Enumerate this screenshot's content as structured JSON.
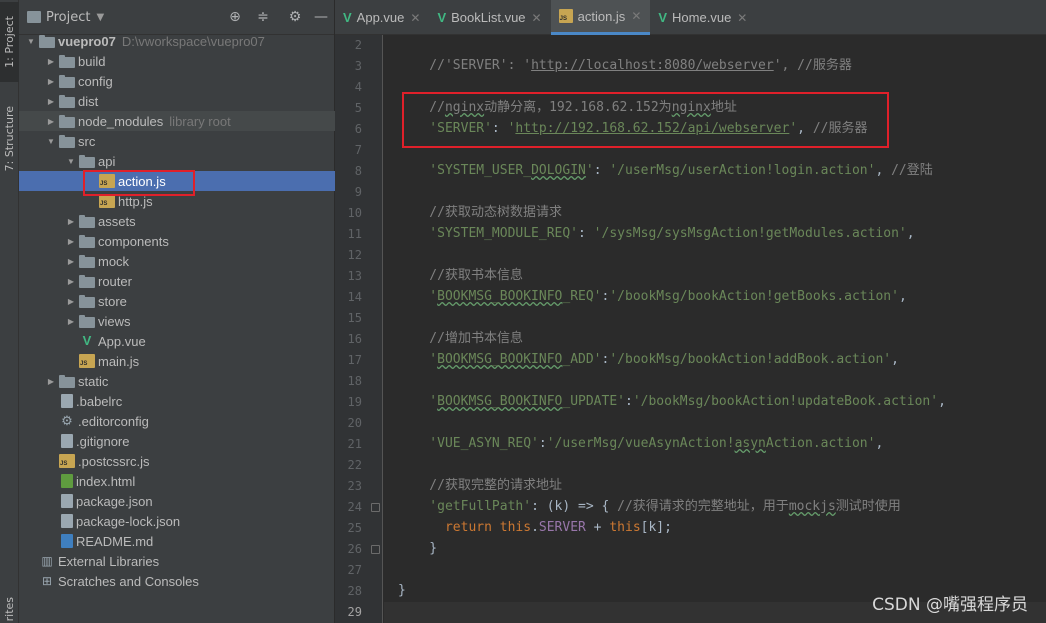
{
  "side_strip": {
    "project_tab": "1: Project",
    "structure_tab": "7: Structure",
    "bottom_tab": "rites"
  },
  "project_panel": {
    "title": "Project",
    "tree": [
      {
        "label": "vuepro07",
        "extra": "D:\\vworkspace\\vuepro07",
        "type": "folder",
        "depth": 0,
        "expanded": true
      },
      {
        "label": "build",
        "type": "folder",
        "depth": 1,
        "expanded": false
      },
      {
        "label": "config",
        "type": "folder",
        "depth": 1,
        "expanded": false
      },
      {
        "label": "dist",
        "type": "folder",
        "depth": 1,
        "expanded": false
      },
      {
        "label": "node_modules",
        "extra": "library root",
        "type": "folder",
        "depth": 1,
        "expanded": false,
        "highlight": true
      },
      {
        "label": "src",
        "type": "folder",
        "depth": 1,
        "expanded": true
      },
      {
        "label": "api",
        "type": "folder",
        "depth": 2,
        "expanded": true
      },
      {
        "label": "action.js",
        "type": "js",
        "depth": 3,
        "selected": true
      },
      {
        "label": "http.js",
        "type": "js",
        "depth": 3
      },
      {
        "label": "assets",
        "type": "folder",
        "depth": 2,
        "expanded": false
      },
      {
        "label": "components",
        "type": "folder",
        "depth": 2,
        "expanded": false
      },
      {
        "label": "mock",
        "type": "folder",
        "depth": 2,
        "expanded": false
      },
      {
        "label": "router",
        "type": "folder",
        "depth": 2,
        "expanded": false
      },
      {
        "label": "store",
        "type": "folder",
        "depth": 2,
        "expanded": false
      },
      {
        "label": "views",
        "type": "folder",
        "depth": 2,
        "expanded": false
      },
      {
        "label": "App.vue",
        "type": "vue",
        "depth": 2
      },
      {
        "label": "main.js",
        "type": "js",
        "depth": 2
      },
      {
        "label": "static",
        "type": "folder",
        "depth": 1,
        "expanded": false
      },
      {
        "label": ".babelrc",
        "type": "file",
        "depth": 1
      },
      {
        "label": ".editorconfig",
        "type": "gear",
        "depth": 1
      },
      {
        "label": ".gitignore",
        "type": "file",
        "depth": 1
      },
      {
        "label": ".postcssrc.js",
        "type": "js",
        "depth": 1
      },
      {
        "label": "index.html",
        "type": "html",
        "depth": 1
      },
      {
        "label": "package.json",
        "type": "file",
        "depth": 1
      },
      {
        "label": "package-lock.json",
        "type": "file",
        "depth": 1
      },
      {
        "label": "README.md",
        "type": "md",
        "depth": 1
      },
      {
        "label": "External Libraries",
        "type": "lib",
        "depth": 0
      },
      {
        "label": "Scratches and Consoles",
        "type": "scratch",
        "depth": 0
      }
    ]
  },
  "editor": {
    "tabs": [
      {
        "label": "App.vue",
        "icon": "vue-icon",
        "active": false
      },
      {
        "label": "BookList.vue",
        "icon": "vue-icon",
        "active": false
      },
      {
        "label": "action.js",
        "icon": "js-icon",
        "active": true
      },
      {
        "label": "Home.vue",
        "icon": "vue-icon",
        "active": false
      }
    ],
    "current_line": 29,
    "lines": [
      {
        "n": 2,
        "parts": []
      },
      {
        "n": 3,
        "parts": [
          [
            "c",
            "    //'SERVER': '"
          ],
          [
            "c u",
            "http://localhost:8080/webserver"
          ],
          [
            "c",
            "', //服务器"
          ]
        ]
      },
      {
        "n": 4,
        "parts": []
      },
      {
        "n": 5,
        "parts": [
          [
            "c",
            "    //"
          ],
          [
            "c w",
            "nginx"
          ],
          [
            "c",
            "动静分离，192.168.62.152为"
          ],
          [
            "c w",
            "nginx"
          ],
          [
            "c",
            "地址"
          ]
        ]
      },
      {
        "n": 6,
        "parts": [
          [
            "s",
            "    'SERVER'"
          ],
          [
            "op",
            ": "
          ],
          [
            "s",
            "'"
          ],
          [
            "s u",
            "http://192.168.62.152/api/webserver"
          ],
          [
            "s",
            "'"
          ],
          [
            "op",
            ", "
          ],
          [
            "c",
            "//服务器"
          ]
        ]
      },
      {
        "n": 7,
        "parts": []
      },
      {
        "n": 8,
        "parts": [
          [
            "s",
            "    'SYSTEM_USER_"
          ],
          [
            "s w",
            "DOLOGIN"
          ],
          [
            "s",
            "'"
          ],
          [
            "op",
            ": "
          ],
          [
            "s",
            "'/userMsg/userAction!login.action'"
          ],
          [
            "op",
            ", "
          ],
          [
            "c",
            "//登陆"
          ]
        ]
      },
      {
        "n": 9,
        "parts": []
      },
      {
        "n": 10,
        "parts": [
          [
            "c",
            "    //获取动态树数据请求"
          ]
        ]
      },
      {
        "n": 11,
        "parts": [
          [
            "s",
            "    'SYSTEM_MODULE_REQ'"
          ],
          [
            "op",
            ": "
          ],
          [
            "s",
            "'/sysMsg/sysMsgAction!getModules.action'"
          ],
          [
            "op",
            ","
          ]
        ]
      },
      {
        "n": 12,
        "parts": []
      },
      {
        "n": 13,
        "parts": [
          [
            "c",
            "    //获取书本信息"
          ]
        ]
      },
      {
        "n": 14,
        "parts": [
          [
            "s",
            "    '"
          ],
          [
            "s w",
            "BOOKMSG_BOOKINFO"
          ],
          [
            "s",
            "_REQ'"
          ],
          [
            "op",
            ":"
          ],
          [
            "s",
            "'/bookMsg/bookAction!getBooks.action'"
          ],
          [
            "op",
            ","
          ]
        ]
      },
      {
        "n": 15,
        "parts": []
      },
      {
        "n": 16,
        "parts": [
          [
            "c",
            "    //增加书本信息"
          ]
        ]
      },
      {
        "n": 17,
        "parts": [
          [
            "s",
            "    '"
          ],
          [
            "s w",
            "BOOKMSG_BOOKINFO"
          ],
          [
            "s",
            "_ADD'"
          ],
          [
            "op",
            ":"
          ],
          [
            "s",
            "'/bookMsg/bookAction!addBook.action'"
          ],
          [
            "op",
            ","
          ]
        ]
      },
      {
        "n": 18,
        "parts": []
      },
      {
        "n": 19,
        "parts": [
          [
            "s",
            "    '"
          ],
          [
            "s w",
            "BOOKMSG_BOOKINFO"
          ],
          [
            "s",
            "_UPDATE'"
          ],
          [
            "op",
            ":"
          ],
          [
            "s",
            "'/bookMsg/bookAction!updateBook.action'"
          ],
          [
            "op",
            ","
          ]
        ]
      },
      {
        "n": 20,
        "parts": []
      },
      {
        "n": 21,
        "parts": [
          [
            "s",
            "    'VUE_ASYN_REQ'"
          ],
          [
            "op",
            ":"
          ],
          [
            "s",
            "'/userMsg/vueAsynAction!"
          ],
          [
            "s w",
            "asyn"
          ],
          [
            "s",
            "Action.action'"
          ],
          [
            "op",
            ","
          ]
        ]
      },
      {
        "n": 22,
        "parts": []
      },
      {
        "n": 23,
        "parts": [
          [
            "c",
            "    //获取完整的请求地址"
          ]
        ]
      },
      {
        "n": 24,
        "parts": [
          [
            "s",
            "    'getFullPath'"
          ],
          [
            "op",
            ": (k) => { "
          ],
          [
            "c",
            "//获得请求的完整地址，用于"
          ],
          [
            "c w",
            "mockjs"
          ],
          [
            "c",
            "测试时使用"
          ]
        ]
      },
      {
        "n": 25,
        "parts": [
          [
            "k",
            "      return "
          ],
          [
            "k",
            "this"
          ],
          [
            "op",
            "."
          ],
          [
            "p",
            "SERVER"
          ],
          [
            "op",
            " + "
          ],
          [
            "k",
            "this"
          ],
          [
            "op",
            "[k];"
          ]
        ]
      },
      {
        "n": 26,
        "parts": [
          [
            "op",
            "    }"
          ]
        ]
      },
      {
        "n": 27,
        "parts": []
      },
      {
        "n": 28,
        "parts": [
          [
            "op",
            "}"
          ]
        ]
      },
      {
        "n": 29,
        "parts": []
      }
    ]
  },
  "watermark": "CSDN @嘴强程序员",
  "colors": {
    "selection": "#4b6eaf",
    "annotation_red": "#e0202a",
    "string": "#6a8759",
    "comment": "#808080",
    "keyword": "#cc7832"
  }
}
